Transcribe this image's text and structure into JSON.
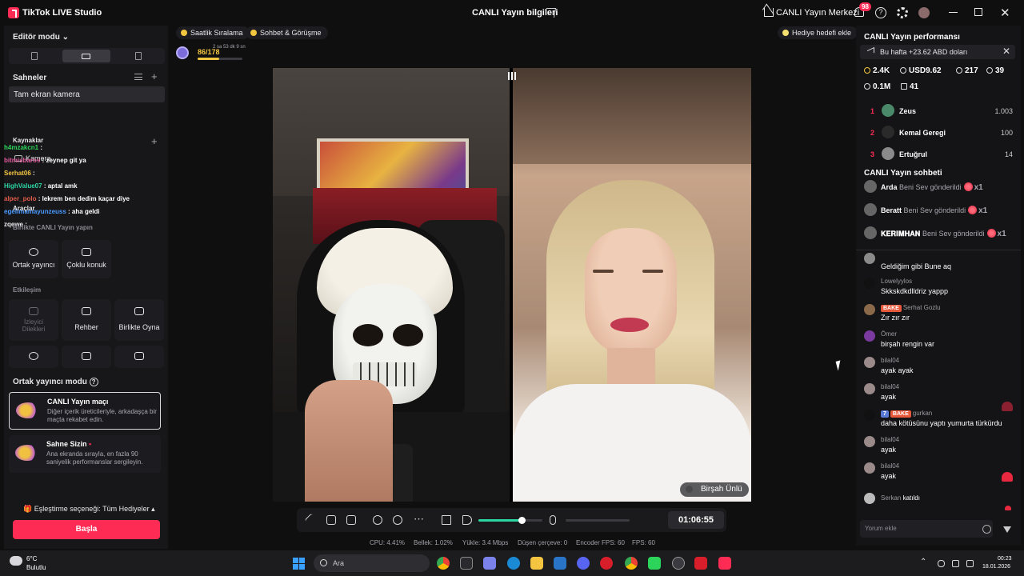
{
  "titlebar": {
    "app_title": "TikTok LIVE Studio",
    "live_info": "CANLI Yayın bilgileri",
    "live_center": "CANLI Yayın Merkezi",
    "notification_count": "98"
  },
  "left": {
    "editor_mode": "Editör modu",
    "scenes_title": "Sahneler",
    "scene_item": "Tam ekran kamera",
    "sources_title": "Kaynaklar",
    "camera_label": "Kamera",
    "tools_title": "Araçlar",
    "together_title": "Birlikte CANLI Yayın yapın",
    "cohost_btn": "Ortak yayıncı",
    "multi_guest_btn": "Çoklu konuk",
    "interaction_title": "Etkileşim",
    "viewer_requests_btn": "İzleyici Dilekleri",
    "guide_btn": "Rehber",
    "play_together_btn": "Birlikte Oyna",
    "cohost_mode_title": "Ortak yayıncı modu",
    "card1_title": "CANLI Yayın maçı",
    "card1_desc": "Diğer içerik üreticileriyle, arkadaşça bir maçta rekabet edin.",
    "card2_title": "Sahne Sizin",
    "card2_desc": "Ana ekranda sırayla, en fazla 90 saniyelik performanslar sergileyin.",
    "pairing": "Eşleştirme seçeneği: Tüm Hediyeler",
    "start_btn": "Başla"
  },
  "overlay_chat": [
    {
      "user": "h4mzakcn1",
      "msg": ":",
      "color": "#2cd55a"
    },
    {
      "user": "bitmisbaros",
      "msg": ": zeynep git ya",
      "color": "#e05a9a"
    },
    {
      "user": "Serhat06",
      "msg": ":",
      "color": "#f3c63f"
    },
    {
      "user": "HighValue07",
      "msg": ": aptal amk",
      "color": "#2cd5a4"
    },
    {
      "user": "alper_polo",
      "msg": ": lekrem ben dedim kaçar diye",
      "color": "#e05a4a"
    },
    {
      "user": "egelimamayunzeuss",
      "msg": ": aha geldi",
      "color": "#4a9aff"
    },
    {
      "user": "zqewe",
      "msg": ":",
      "color": "#e8e8ea"
    }
  ],
  "center": {
    "pill1": "Saatlik Sıralama",
    "pill2": "Sohbet & Görüşme",
    "gift_goal": "Hediye hedefi ekle",
    "level_progress": "86/178",
    "level_time": "2 sa 53 dk 9 sn",
    "level_fraction": 0.48,
    "guest_label": "Birşah Ünlü",
    "timer": "01:06:55",
    "volume": 0.68
  },
  "stats": {
    "cpu": "CPU: 4.41%",
    "memory": "Bellek: 1.02%",
    "upload": "Yükle: 3.4 Mbps",
    "dropped": "Düşen çerçeve: 0",
    "encoder_fps": "Encoder FPS: 60",
    "fps": "FPS: 60"
  },
  "right": {
    "perf_title": "CANLI Yayın performansı",
    "earnings": "Bu hafta +23.62 ABD doları",
    "s_diamonds": "2.4K",
    "s_usd": "USD9.62",
    "s_viewers": "217",
    "s_new": "39",
    "s_likes": "0.1M",
    "s_gifts": "41",
    "ranking": [
      {
        "rank": "1",
        "name": "Zeus",
        "score": "1.003"
      },
      {
        "rank": "2",
        "name": "Kemal Geregi",
        "score": "100"
      },
      {
        "rank": "3",
        "name": "Ertuğrul",
        "score": "14"
      }
    ],
    "chat_title": "CANLI Yayın sohbeti",
    "gifts": [
      {
        "name": "Arda",
        "text": "Beni Sev gönderildi",
        "count": "x1"
      },
      {
        "name": "Beratt",
        "text": "Beni Sev gönderildi",
        "count": "x1"
      },
      {
        "name": "𝐊𝐄𝐑𝐈𝐌𝐇𝐀𝐍",
        "text": "Beni Sev gönderildi",
        "count": "x1"
      }
    ],
    "chat": [
      {
        "user": "",
        "msg": "Geldiğim gibi Bune aq"
      },
      {
        "user": "Lowelyylos",
        "msg": "Skkskdkdlldriz yappp"
      },
      {
        "user": "Serhat Gozlu",
        "msg": "Zır zır zır"
      },
      {
        "user": "Ömer",
        "msg": "birşah rengin var"
      },
      {
        "user": "bilal04",
        "msg": "ayak ayak"
      },
      {
        "user": "bilal04",
        "msg": "ayak"
      },
      {
        "user": "gurkan",
        "msg": "daha kötüsünu yaptı yumurta türkürdu"
      },
      {
        "user": "bilal04",
        "msg": "ayak"
      },
      {
        "user": "bilal04",
        "msg": "ayak"
      },
      {
        "user": "Serkan",
        "msg": "katıldı"
      }
    ],
    "badge_bake": "BAKE",
    "badge_level": "7",
    "comment_placeholder": "Yorum ekle"
  },
  "taskbar": {
    "temp": "6°C",
    "weather": "Bulutlu",
    "search": "Ara",
    "time": "00:23",
    "date": "18.01.2026"
  },
  "colors": {
    "accent": "#fe2c55",
    "volume": "#2cd5a4",
    "gold": "#f3c63f"
  }
}
